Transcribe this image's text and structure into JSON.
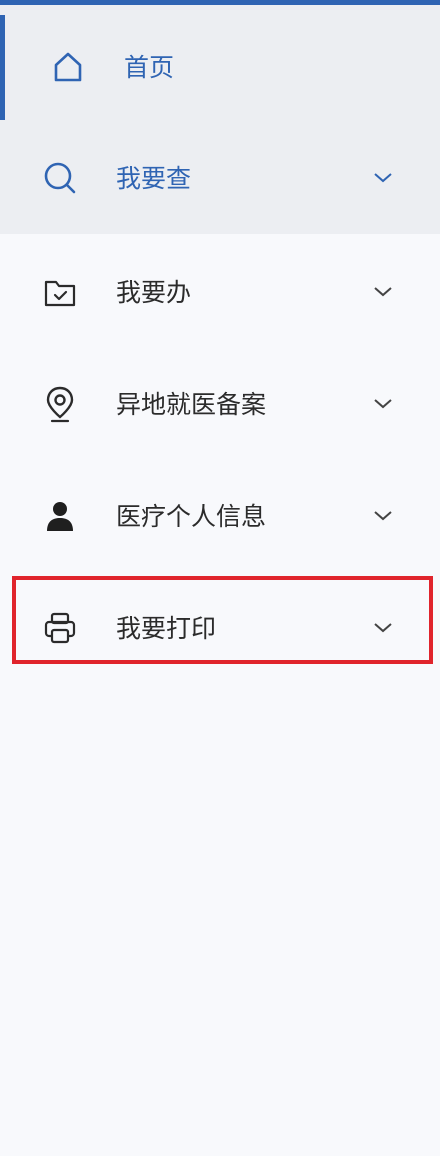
{
  "nav": {
    "home": {
      "label": "首页",
      "icon": "home-icon"
    },
    "query": {
      "label": "我要查",
      "icon": "search-icon"
    },
    "do": {
      "label": "我要办",
      "icon": "folder-check-icon"
    },
    "remote": {
      "label": "异地就医备案",
      "icon": "location-pin-icon"
    },
    "personal": {
      "label": "医疗个人信息",
      "icon": "person-icon"
    },
    "print": {
      "label": "我要打印",
      "icon": "printer-icon"
    }
  },
  "colors": {
    "accent": "#2f64b3",
    "highlight": "#e0242c",
    "active_bg": "#eceef2"
  }
}
